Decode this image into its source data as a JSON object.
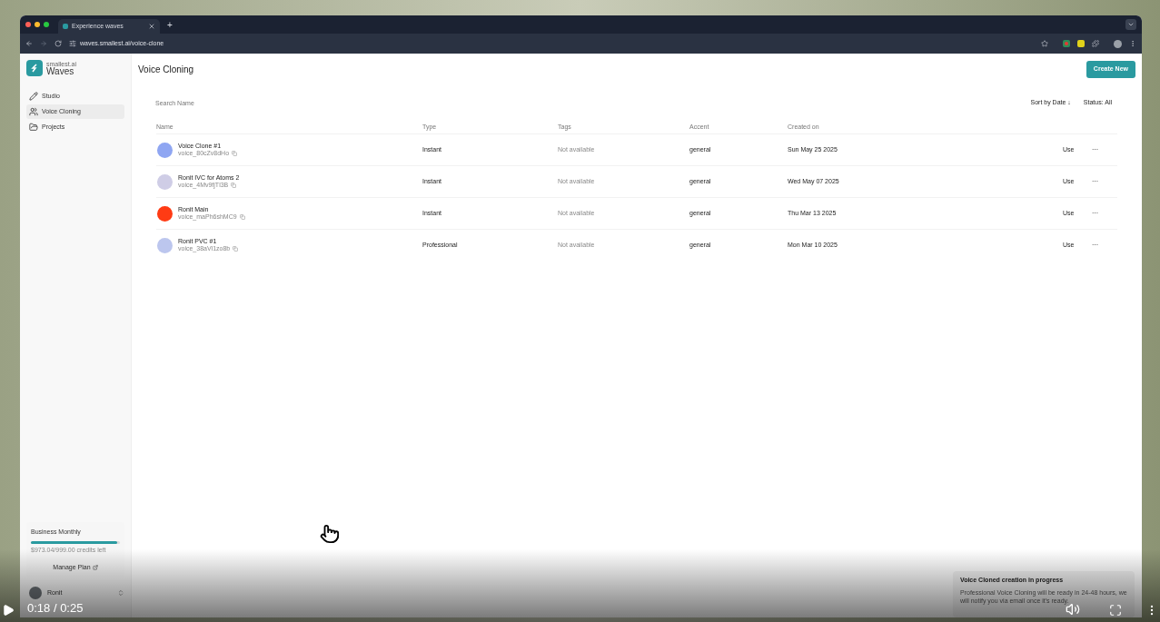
{
  "browser": {
    "tab_title": "Experience waves",
    "new_tab": "+",
    "url": "waves.smallest.ai/voice-clone"
  },
  "sidebar": {
    "brand_small": "smallest.ai",
    "brand": "Waves",
    "items": [
      {
        "label": "Studio",
        "selected": false
      },
      {
        "label": "Voice Cloning",
        "selected": true
      },
      {
        "label": "Projects",
        "selected": false
      }
    ],
    "plan": {
      "name": "Business Monthly",
      "level": 0.97,
      "credits": "$973.04/999.00 credits left",
      "manage": "Manage Plan"
    },
    "user": {
      "name": "Ronit"
    }
  },
  "main": {
    "title": "Voice Cloning",
    "create_button": "Create New",
    "search": {
      "placeholder": "Search Name"
    },
    "sort": "Sort by Date ↓",
    "status": "Status: All",
    "table": {
      "columns": [
        "Name",
        "Type",
        "Tags",
        "Accent",
        "Created on"
      ],
      "rows": [
        {
          "name": "Voice Clone #1",
          "id": "voice_80cZv8dHo",
          "color": "#8fa6f2",
          "type": "Instant",
          "tags": "Not available",
          "accent": "general",
          "created": "Sun May 25 2025",
          "action": "Use",
          "more": "···"
        },
        {
          "name": "Ronit IVC for Atoms 2",
          "id": "voice_4Mv9fjTl3B",
          "color": "#cfcde6",
          "type": "Instant",
          "tags": "Not available",
          "accent": "general",
          "created": "Wed May 07 2025",
          "action": "Use",
          "more": "···"
        },
        {
          "name": "Ronit Main",
          "id": "voice_maPh6shMC9",
          "color": "#ff3b14",
          "type": "Instant",
          "tags": "Not available",
          "accent": "general",
          "created": "Thu Mar 13 2025",
          "action": "Use",
          "more": "···"
        },
        {
          "name": "Ronit PVC #1",
          "id": "voice_38aVl1zo8b",
          "color": "#bcc6ee",
          "type": "Professional",
          "tags": "Not available",
          "accent": "general",
          "created": "Mon Mar 10 2025",
          "action": "Use",
          "more": "···"
        }
      ]
    }
  },
  "toast": {
    "title": "Voice Cloned creation in progress",
    "message": "Professional Voice Cloning will be ready in 24-48 hours, we will notify you via email once it's ready."
  },
  "player": {
    "time": "0:18 / 0:25"
  }
}
